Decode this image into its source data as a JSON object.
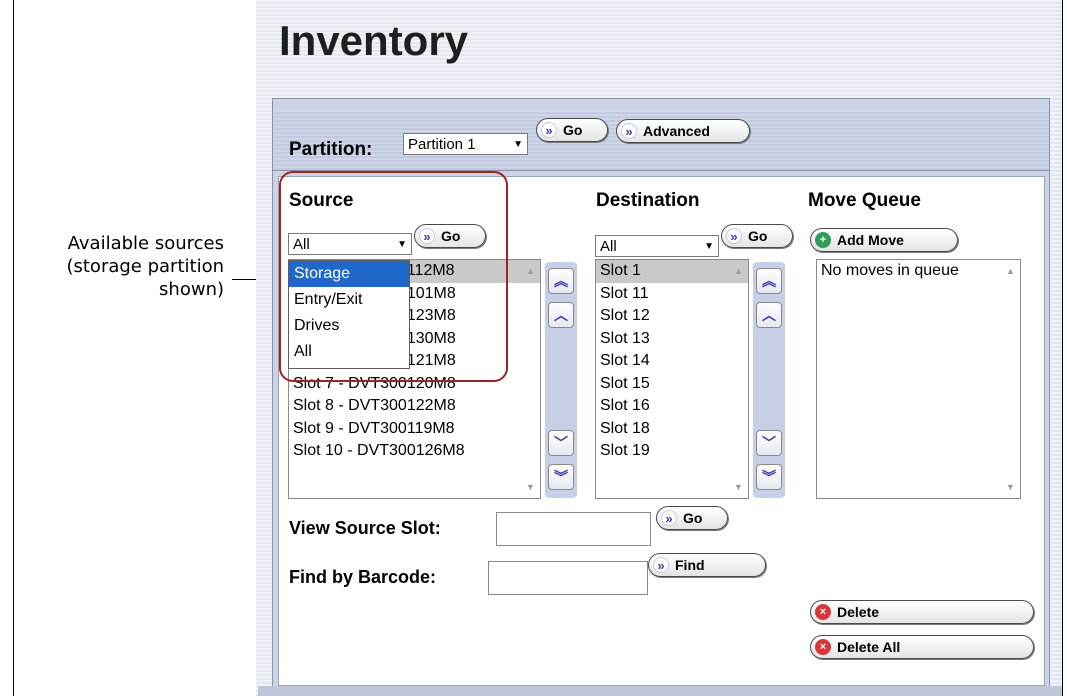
{
  "callout": {
    "line1": "Available sources",
    "line2": "(storage partition",
    "line3": "shown)"
  },
  "page_title": "Inventory",
  "partition": {
    "label": "Partition:",
    "selected": "Partition 1",
    "go_label": "Go",
    "advanced_label": "Advanced"
  },
  "source": {
    "heading": "Source",
    "filter_selected": "All",
    "go_label": "Go",
    "dropdown_options": [
      "Storage",
      "Entry/Exit",
      "Drives",
      "All"
    ],
    "items": [
      "Slot 1 - DVT300112M8",
      "Slot 2 - DVT300101M8",
      "Slot 3 - DVT300123M8",
      "Slot 4 - DVT300130M8",
      "Slot 6 - DVT300121M8",
      "Slot 7 - DVT300120M8",
      "Slot 8 - DVT300122M8",
      "Slot 9 - DVT300119M8",
      "Slot 10 - DVT300126M8"
    ]
  },
  "destination": {
    "heading": "Destination",
    "filter_selected": "All",
    "go_label": "Go",
    "items": [
      "Slot 1",
      "Slot 11",
      "Slot 12",
      "Slot 13",
      "Slot 14",
      "Slot 15",
      "Slot 16",
      "Slot 18",
      "Slot 19"
    ]
  },
  "move_queue": {
    "heading": "Move Queue",
    "add_label": "Add Move",
    "empty_text": "No moves in queue",
    "delete_label": "Delete",
    "delete_all_label": "Delete All"
  },
  "view_source": {
    "label": "View Source Slot:",
    "value": "",
    "go_label": "Go"
  },
  "find_barcode": {
    "label": "Find by Barcode:",
    "value": "",
    "find_label": "Find"
  },
  "icons": {
    "chevron": "double-chevron-right",
    "add": "plus-circle",
    "delete": "x-circle"
  },
  "colors": {
    "panel_bg": "#e3e7ef",
    "box_bg": "#cdd3e6",
    "dropdown_highlight": "#1f67c8",
    "callout_ring": "#9b2424",
    "add_icon": "#2f9c57",
    "delete_icon": "#d6363c"
  }
}
